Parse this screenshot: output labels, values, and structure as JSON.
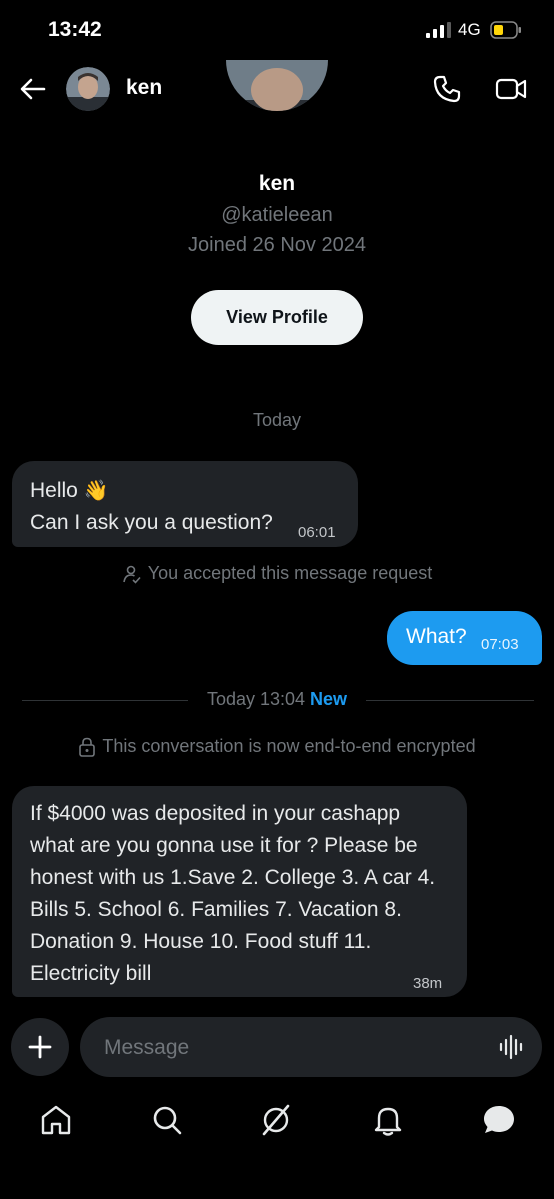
{
  "status_bar": {
    "time": "13:42",
    "network": "4G",
    "battery_color": "#ffd60a"
  },
  "header": {
    "name": "ken"
  },
  "profile": {
    "name": "ken",
    "handle": "@katieleean",
    "joined": "Joined 26 Nov 2024",
    "view_profile_label": "View Profile"
  },
  "date_label": "Today",
  "messages": [
    {
      "direction": "incoming",
      "lines": [
        "Hello",
        "Can I ask you a question?"
      ],
      "emoji": "👋",
      "time": "06:01"
    },
    {
      "direction": "outgoing",
      "text": "What?",
      "time": "07:03"
    },
    {
      "direction": "incoming",
      "text": "If $4000 was deposited in your cashapp what are you gonna use it for ? Please be honest with us 1.Save 2. College 3. A car 4. Bills 5. School 6. Families 7. Vacation 8. Donation 9. House 10. Food stuff 11. Electricity bill",
      "time": "38m"
    }
  ],
  "system": {
    "accepted": "You accepted this message request",
    "divider_time": "Today 13:04",
    "divider_new": "New",
    "encrypted": "This conversation is now end-to-end encrypted"
  },
  "composer": {
    "placeholder": "Message"
  },
  "tabs": [
    "home-icon",
    "search-icon",
    "grok-icon",
    "notifications-icon",
    "messages-icon"
  ],
  "colors": {
    "accent": "#1d9bf0",
    "bubble_in": "#202327",
    "muted": "#71767b"
  }
}
